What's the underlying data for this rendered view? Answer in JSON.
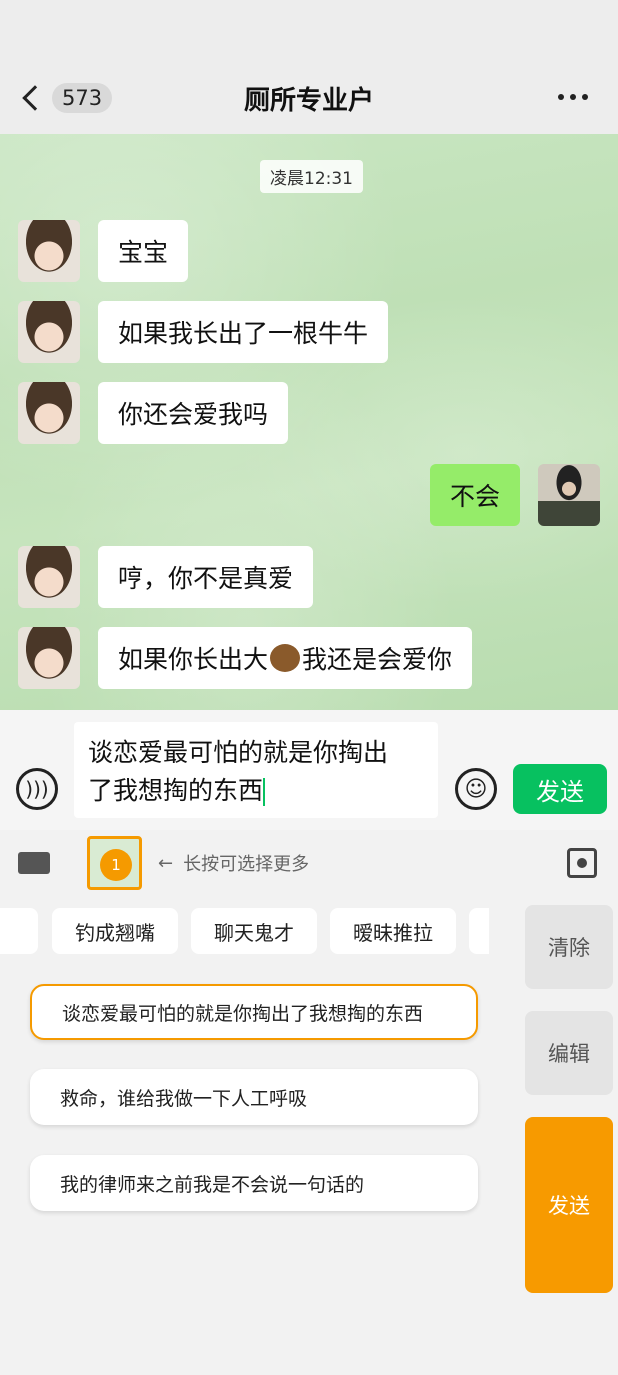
{
  "header": {
    "unread_count": "573",
    "title": "厕所专业户"
  },
  "chat": {
    "timestamp": "凌晨12:31",
    "messages": [
      {
        "side": "left",
        "text": "宝宝"
      },
      {
        "side": "left",
        "text": "如果我长出了一根牛牛"
      },
      {
        "side": "left",
        "text": "你还会爱我吗"
      },
      {
        "side": "right",
        "text": "不会"
      },
      {
        "side": "left",
        "text": "哼，你不是真爱"
      },
      {
        "side": "left",
        "text_before": "如果你长出大",
        "emoji": "bear-emoji",
        "text_after": "我还是会爱你"
      }
    ]
  },
  "input": {
    "line1": "谈恋爱最可怕的就是你掏出",
    "line2": "了我想掏的东西",
    "send_label": "发送"
  },
  "panel": {
    "thumb_count": "1",
    "hint": "长按可选择更多",
    "chips": [
      "钓成翘嘴",
      "聊天鬼才",
      "暧昧推拉"
    ],
    "suggestions": [
      "谈恋爱最可怕的就是你掏出了我想掏的东西",
      "救命，谁给我做一下人工呼吸",
      "我的律师来之前我是不会说一句话的"
    ],
    "clear_label": "清除",
    "edit_label": "编辑",
    "send_label": "发送"
  }
}
